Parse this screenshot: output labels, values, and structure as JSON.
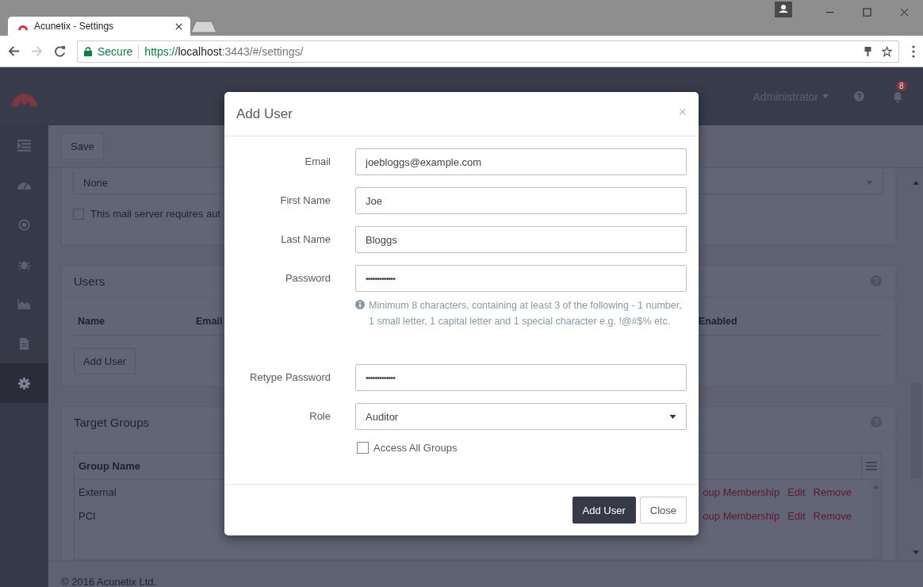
{
  "browser": {
    "tab_title": "Acunetix - Settings",
    "secure": "Secure",
    "url_scheme": "https://",
    "url_host": "localhost",
    "url_rest": ":3443/#/settings/"
  },
  "header": {
    "user": "Administrator",
    "notifications": "8"
  },
  "sidebar": {
    "items": [
      {
        "kind": "list",
        "selected": false
      },
      {
        "kind": "gauge",
        "selected": false
      },
      {
        "kind": "target",
        "selected": false
      },
      {
        "kind": "bug",
        "selected": false
      },
      {
        "kind": "chart",
        "selected": false
      },
      {
        "kind": "document",
        "selected": false
      },
      {
        "kind": "gear",
        "selected": true
      }
    ]
  },
  "toolbar": {
    "save": "Save"
  },
  "mail": {
    "security": "None",
    "auth_label": "This mail server requires aut",
    "auth_checked": false
  },
  "users": {
    "title": "Users",
    "columns": [
      "Name",
      "Email",
      "Enabled"
    ],
    "add_button": "Add User"
  },
  "target_groups": {
    "title": "Target Groups",
    "column": "Group Name",
    "rows": [
      {
        "name": "External",
        "actions": [
          "oup Membership",
          "Edit",
          "Remove"
        ]
      },
      {
        "name": "PCI",
        "actions": [
          "oup Membership",
          "Edit",
          "Remove"
        ]
      }
    ]
  },
  "footer": "© 2016 Acunetix Ltd.",
  "modal": {
    "title": "Add User",
    "close": "×",
    "fields": [
      {
        "kind": "text",
        "label": "Email",
        "value": "joebloggs@example.com"
      },
      {
        "kind": "text",
        "label": "First Name",
        "value": "Joe"
      },
      {
        "kind": "text",
        "label": "Last Name",
        "value": "Bloggs"
      },
      {
        "kind": "password",
        "label": "Password",
        "value": "•••••••••••••",
        "help": "Minimum 8 characters, containing at least 3 of the following - 1 number, 1 small letter, 1 capital letter and 1 special character e.g. !@#$% etc."
      },
      {
        "kind": "password",
        "label": "Retype Password",
        "value": "•••••••••••••"
      },
      {
        "kind": "select",
        "label": "Role",
        "value": "Auditor"
      }
    ],
    "access_all_groups": {
      "label": "Access All Groups",
      "checked": false
    },
    "buttons": [
      {
        "kind": "primary",
        "label": "Add User"
      },
      {
        "kind": "default",
        "label": "Close"
      }
    ]
  }
}
